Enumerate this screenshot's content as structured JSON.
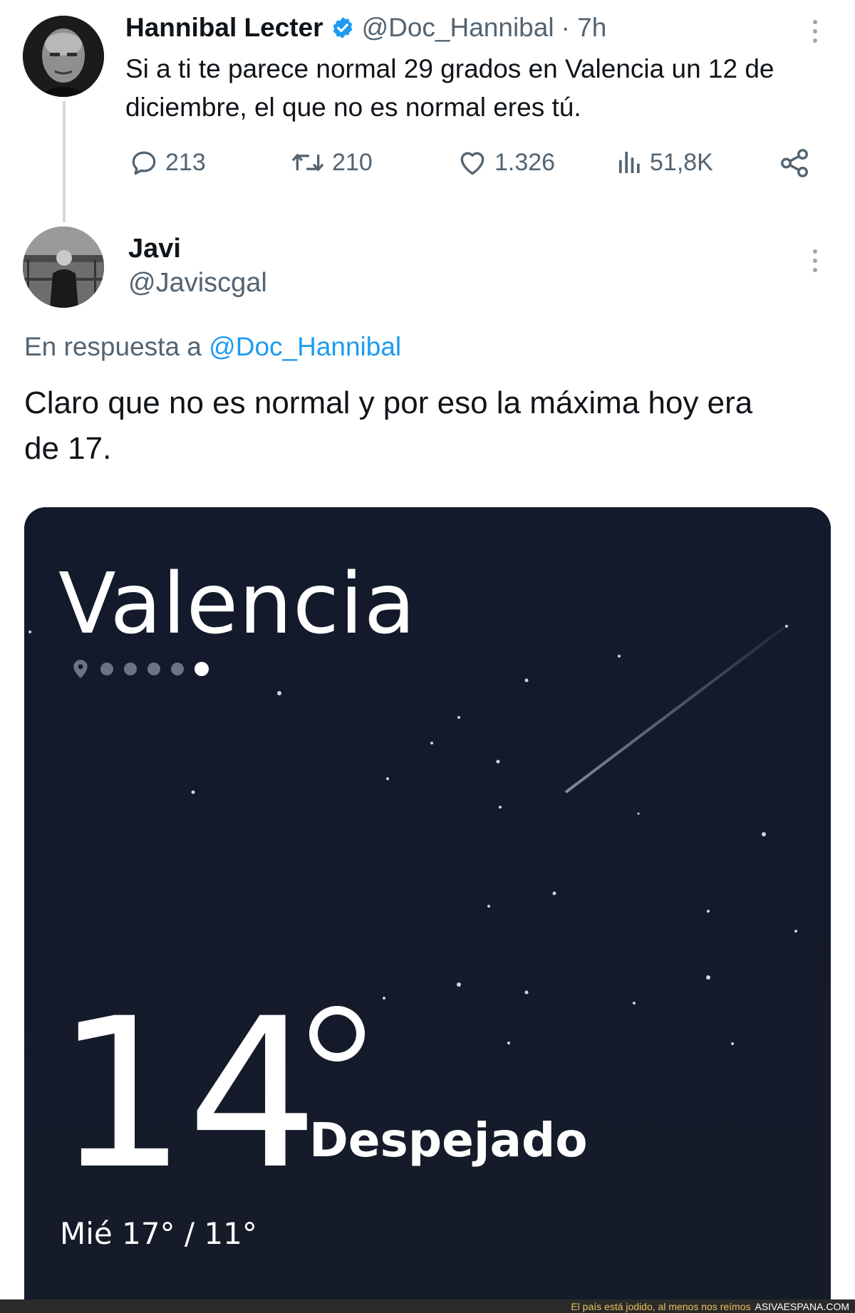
{
  "tweet": {
    "author_name": "Hannibal Lecter",
    "author_handle": "@Doc_Hannibal",
    "time": "· 7h",
    "text_line1": "Si a ti te parece normal 29 grados en Valencia un 12 de",
    "text_line2": "diciembre, el que no es normal eres tú.",
    "verified_color": "#1d9bf0",
    "actions": {
      "replies": "213",
      "retweets": "210",
      "likes": "1.326",
      "views": "51,8K"
    }
  },
  "reply": {
    "author_name": "Javi",
    "author_handle": "@Javiscgal",
    "in_reply_prefix": "En respuesta a",
    "in_reply_mention": "@Doc_Hannibal",
    "text_line1": "Claro que no es normal y por eso la máxima hoy era",
    "text_line2": "de 17."
  },
  "weather": {
    "city": "Valencia",
    "temperature": "14",
    "condition": "Despejado",
    "day_minmax": "Mié 17° / 11°",
    "page_count": 6,
    "active_page": 6
  },
  "footer": {
    "caption": "El país está jodido, al menos nos reímos",
    "site": "ASIVAESPANA.COM"
  },
  "colors": {
    "accent": "#1d9bf0",
    "secondary_text": "#536471",
    "card_background": "#141a2b"
  }
}
